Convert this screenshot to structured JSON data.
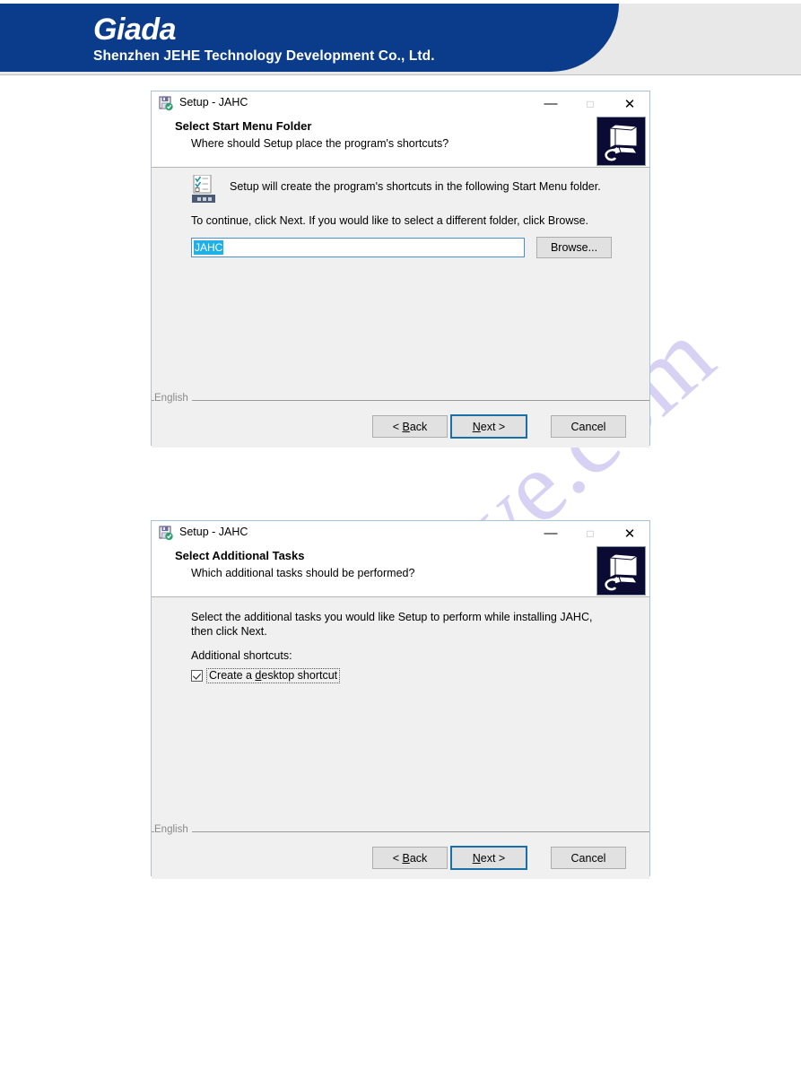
{
  "page": {
    "brand": {
      "logo_text": "Giada",
      "company": "Shenzhen JEHE Technology Development Co., Ltd."
    },
    "watermark": "manualshive.com",
    "colors": {
      "brand_blue": "#0b3c8c",
      "header_background": "#e8e8e8",
      "dialog_body": "#f0f0f0",
      "focus_blue": "#1a6fa8",
      "selection_blue": "#1fb0e8",
      "watermark_purple": "#c9c2f0"
    }
  },
  "dialogs": [
    {
      "title": "Setup - JAHC",
      "title_icon": "installer-icon",
      "window_controls": {
        "minimize": "—",
        "maximize": "□",
        "close": "✕"
      },
      "header": {
        "heading": "Select Start Menu Folder",
        "subheading": "Where should Setup place the program's shortcuts?",
        "banner_icon": "computer-monitor-icon"
      },
      "body": {
        "icon": "checklist-icon",
        "line1": "Setup will create the program's shortcuts in the following Start Menu folder.",
        "line2": "To continue, click Next. If you would like to select a different folder, click Browse.",
        "folder_input_value": "JAHC",
        "browse_label": "Browse..."
      },
      "footer": {
        "language": "English",
        "back_label_pre": "< ",
        "back_label_accel": "B",
        "back_label_post": "ack",
        "next_label_pre": "",
        "next_label_accel": "N",
        "next_label_post": "ext >",
        "cancel_label": "Cancel"
      }
    },
    {
      "title": "Setup - JAHC",
      "title_icon": "installer-icon",
      "window_controls": {
        "minimize": "—",
        "maximize": "□",
        "close": "✕"
      },
      "header": {
        "heading": "Select Additional Tasks",
        "subheading": "Which additional tasks should be performed?",
        "banner_icon": "computer-monitor-icon"
      },
      "body": {
        "line1": "Select the additional tasks you would like Setup to perform while installing JAHC, then click Next.",
        "line2": "Additional shortcuts:",
        "checkbox_label_pre": "Create a ",
        "checkbox_label_accel": "d",
        "checkbox_label_post": "esktop shortcut",
        "checkbox_checked": "true"
      },
      "footer": {
        "language": "English",
        "back_label_pre": "< ",
        "back_label_accel": "B",
        "back_label_post": "ack",
        "next_label_pre": "",
        "next_label_accel": "N",
        "next_label_post": "ext >",
        "cancel_label": "Cancel"
      }
    }
  ]
}
